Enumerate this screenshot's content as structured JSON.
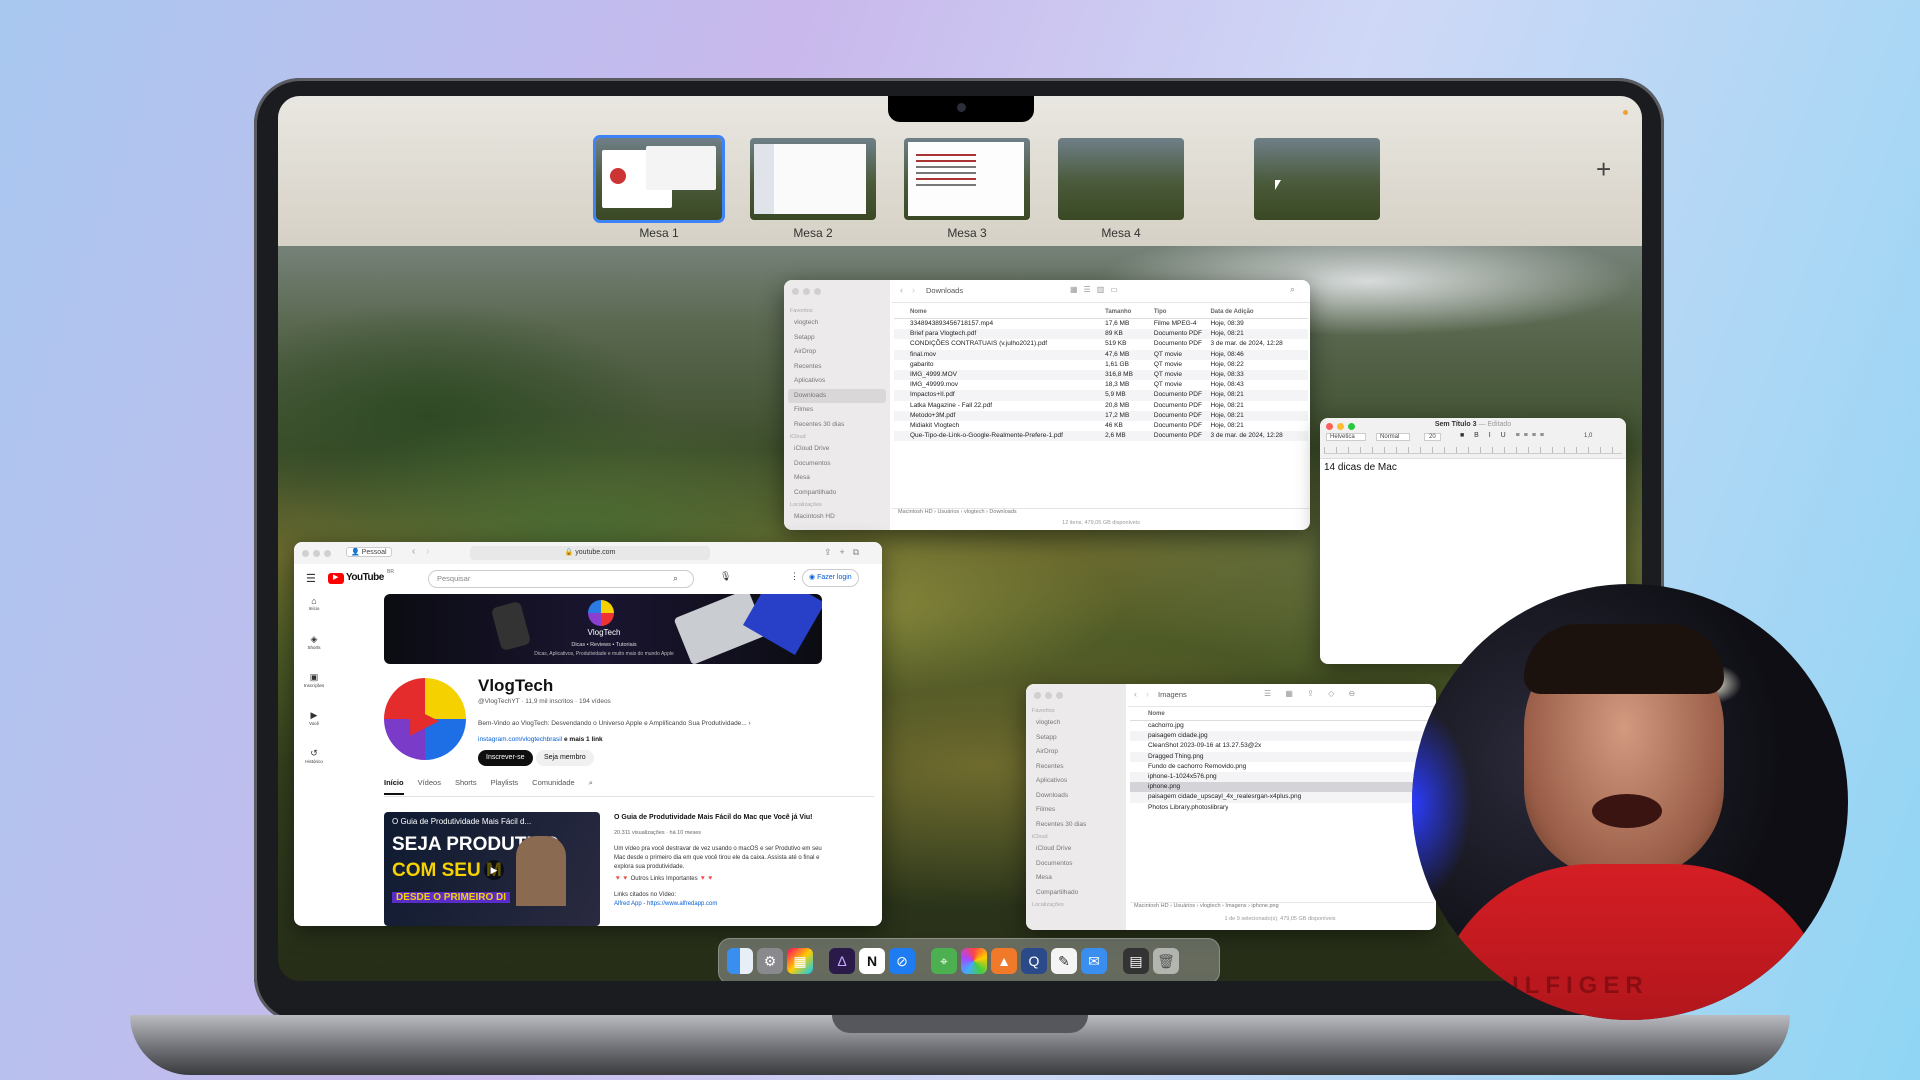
{
  "spaces": {
    "desktops": [
      {
        "label": "Mesa 1",
        "selected": true
      },
      {
        "label": "Mesa 2",
        "selected": false
      },
      {
        "label": "Mesa 3",
        "selected": false
      },
      {
        "label": "Mesa 4",
        "selected": false
      },
      {
        "label": "",
        "selected": false
      }
    ],
    "add_symbol": "+"
  },
  "finder_downloads": {
    "title": "Downloads",
    "sidebar": {
      "favorites_header": "Favoritos",
      "favorites": [
        "vlogtech",
        "Setapp",
        "AirDrop",
        "Recentes",
        "Aplicativos",
        "Downloads",
        "Filmes",
        "Recentes 30 dias"
      ],
      "icloud_header": "iCloud",
      "icloud": [
        "iCloud Drive",
        "Documentos",
        "Mesa",
        "Compartilhado"
      ],
      "locations_header": "Localizações",
      "locations": [
        "Macintosh HD"
      ]
    },
    "columns": [
      "Nome",
      "Tamanho",
      "Tipo",
      "Data de Adição"
    ],
    "rows": [
      [
        "3348943893456718157.mp4",
        "17,6 MB",
        "Filme MPEG-4",
        "Hoje, 08:39"
      ],
      [
        "Brief para Vlogtech.pdf",
        "89 KB",
        "Documento PDF",
        "Hoje, 08:21"
      ],
      [
        "CONDIÇÕES CONTRATUAIS (v.julho2021).pdf",
        "519 KB",
        "Documento PDF",
        "3 de mar. de 2024, 12:28"
      ],
      [
        "final.mov",
        "47,6 MB",
        "QT movie",
        "Hoje, 08:46"
      ],
      [
        "gabarito",
        "1,61 GB",
        "QT movie",
        "Hoje, 08:22"
      ],
      [
        "IMG_4999.MOV",
        "316,8 MB",
        "QT movie",
        "Hoje, 08:33"
      ],
      [
        "IMG_49999.mov",
        "18,3 MB",
        "QT movie",
        "Hoje, 08:43"
      ],
      [
        "Impactos+II.pdf",
        "5,9 MB",
        "Documento PDF",
        "Hoje, 08:21"
      ],
      [
        "Latka Magazine - Fall 22.pdf",
        "20,8 MB",
        "Documento PDF",
        "Hoje, 08:21"
      ],
      [
        "Metodo+3M.pdf",
        "17,2 MB",
        "Documento PDF",
        "Hoje, 08:21"
      ],
      [
        "Midiakit Vlogtech",
        "46 KB",
        "Documento PDF",
        "Hoje, 08:21"
      ],
      [
        "Que-Tipo-de-Link-o-Google-Realmente-Prefere-1.pdf",
        "2,6 MB",
        "Documento PDF",
        "3 de mar. de 2024, 12:28"
      ]
    ],
    "path": [
      "Macintosh HD",
      "Usuários",
      "vlogtech",
      "Downloads"
    ],
    "status": "12 itens, 479,05 GB disponíveis"
  },
  "textedit": {
    "title": "Sem Título 3",
    "subtitle": "— Editado",
    "font": "Helvetica",
    "style": "Normal",
    "size": "20",
    "spacing": "1,0",
    "content": "14 dicas de Mac"
  },
  "safari": {
    "profile": "Pessoal",
    "url": "youtube.com",
    "youtube": {
      "logo": "YouTube",
      "region": "BR",
      "search_placeholder": "Pesquisar",
      "login": "Fazer login",
      "nav": [
        "Início",
        "Shorts",
        "Inscrições",
        "Você",
        "Histórico"
      ],
      "banner_brand": "VlogTech",
      "banner_tagline": "Dicas • Reviews • Tutoriais",
      "banner_sub": "Dicas, Aplicativos, Produtividade e muito mais do mundo Apple",
      "channel_name": "VlogTech",
      "channel_meta": "@VlogTechYT · 11,9 mil inscritos · 194 vídeos",
      "channel_desc": "Bem-Vindo ao VlogTech: Desvendando o Universo Apple e Amplificando Sua Produtividade...",
      "channel_link": "instagram.com/vlogtechbrasil",
      "channel_link_more": "e mais 1 link",
      "subscribe": "Inscrever-se",
      "member": "Seja membro",
      "tabs": [
        "Início",
        "Vídeos",
        "Shorts",
        "Playlists",
        "Comunidade"
      ],
      "video_thumb_title": "O Guia de Produtividade Mais Fácil d...",
      "video_thumb_text1": "SEJA PRODUTIVO",
      "video_thumb_text2": "COM SEU M",
      "video_thumb_text3": "DESDE O PRIMEIRO DI",
      "video_title": "O Guia de Produtividade Mais Fácil do Mac que Você já Viu!",
      "video_meta": "20.311 visualizações · há 10 meses",
      "video_desc": "Um vídeo pra você destravar de vez usando o macOS e ser Produtivo em seu Mac desde o primeiro dia em que você tirou ele da caixa. Assista até o final e explora sua produtividade.",
      "video_links_note": "🔻🔻 Outros Links Importantes 🔻🔻",
      "video_links_header": "Links citados no Vídeo:",
      "video_link": "Alfred App - https://www.alfredapp.com"
    }
  },
  "finder_images": {
    "title": "Imagens",
    "sidebar": {
      "favorites_header": "Favoritos",
      "favorites": [
        "vlogtech",
        "Setapp",
        "AirDrop",
        "Recentes",
        "Aplicativos",
        "Downloads",
        "Filmes",
        "Recentes 30 dias"
      ],
      "icloud_header": "iCloud",
      "icloud": [
        "iCloud Drive",
        "Documentos",
        "Mesa",
        "Compartilhado"
      ],
      "locations_header": "Localizações"
    },
    "column": "Nome",
    "rows": [
      "cachorro.jpg",
      "paisagem cidade.jpg",
      "CleanShot 2023-09-16 at 13.27.53@2x",
      "Dragged Thing.png",
      "Fundo de cachorro Removido.png",
      "iphone-1-1024x576.png",
      "iphone.png",
      "paisagem cidade_upscayl_4x_realesrgan-x4plus.png",
      "Photos Library.photoslibrary"
    ],
    "selected_row": 6,
    "path": [
      "Macintosh HD",
      "Usuários",
      "vlogtech",
      "Imagens",
      "iphone.png"
    ],
    "status": "1 de 9 selecionado(s), 479,05 GB disponíveis"
  },
  "dock": {
    "apps": [
      "finder-icon",
      "settings-icon",
      "launchpad-icon",
      "affinity-icon",
      "notion-icon",
      "safari-icon",
      "maps-icon",
      "photos-icon",
      "affinity-publisher-icon",
      "quicktime-icon",
      "textedit-icon",
      "mail-icon",
      "calculator-icon",
      "trash-icon"
    ]
  },
  "shirt_text": "ILFIGER"
}
